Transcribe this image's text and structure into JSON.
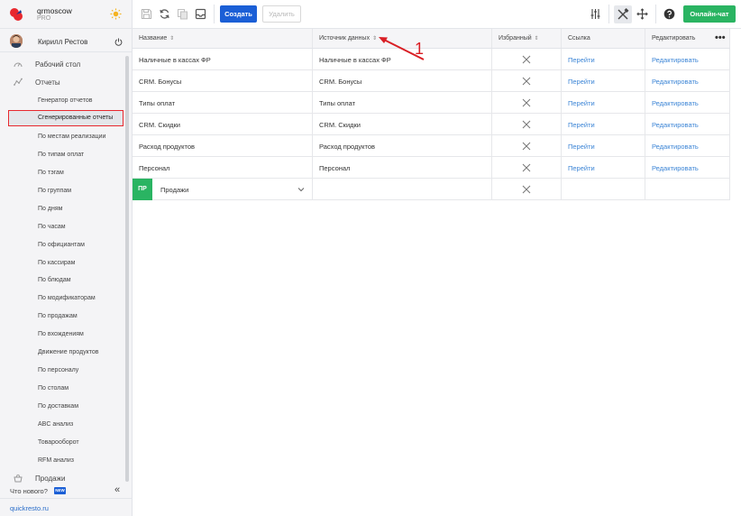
{
  "brand": {
    "name": "qrmoscow",
    "plan": "PRO"
  },
  "user": {
    "name": "Кирилл Рестов"
  },
  "nav": {
    "desktop": "Рабочий стол",
    "reports": "Отчеты",
    "sales": "Продажи",
    "sub_items": [
      "Генератор отчетов",
      "Сгенерированные отчеты",
      "По местам реализации",
      "По типам оплат",
      "По тэгам",
      "По группам",
      "По дням",
      "По часам",
      "По официантам",
      "По кассирам",
      "По блюдам",
      "По модификаторам",
      "По продажам",
      "По вхождениям",
      "Движение продуктов",
      "По персоналу",
      "По столам",
      "По доставкам",
      "ABC анализ",
      "Товарооборот",
      "RFM анализ"
    ]
  },
  "footer": {
    "whats_new": "Что нового?",
    "new_badge": "NEW",
    "site": "quickresto.ru"
  },
  "toolbar": {
    "create": "Создать",
    "delete": "Удалить",
    "chat": "Онлайн-чат"
  },
  "table": {
    "columns": [
      "Название",
      "Источник данных",
      "Избранный",
      "Ссылка",
      "Редактировать"
    ],
    "rows": [
      {
        "name": "Наличные в кассах ФР",
        "source": "Наличные в кассах ФР",
        "link": "Перейти",
        "edit": "Редактировать"
      },
      {
        "name": "CRM. Бонусы",
        "source": "CRM. Бонусы",
        "link": "Перейти",
        "edit": "Редактировать"
      },
      {
        "name": "Типы оплат",
        "source": "Типы оплат",
        "link": "Перейти",
        "edit": "Редактировать"
      },
      {
        "name": "CRM. Скидки",
        "source": "CRM. Скидки",
        "link": "Перейти",
        "edit": "Редактировать"
      },
      {
        "name": "Расход продуктов",
        "source": "Расход продуктов",
        "link": "Перейти",
        "edit": "Редактировать"
      },
      {
        "name": "Персонал",
        "source": "Персонал",
        "link": "Перейти",
        "edit": "Редактировать"
      }
    ],
    "new_row": {
      "badge": "ПР",
      "value": "Продажи"
    }
  },
  "annotation": {
    "number": "1"
  },
  "colors": {
    "accent": "#1b5fd6",
    "chat": "#2ab462",
    "highlight": "#e8282e",
    "link": "#3c85d6"
  }
}
